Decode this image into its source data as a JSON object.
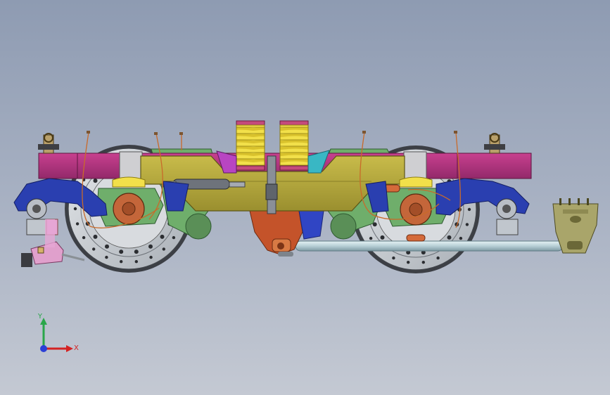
{
  "colors": {
    "background_top": "#8e9bb2",
    "background_bottom": "#c4c9d3",
    "frame_magenta": "#b0357c",
    "bolster_olive": "#b5a83c",
    "spring_yellow": "#f2e04a",
    "wheel_gray": "#cfd3d8",
    "hub_copper": "#c4663a",
    "arm_blue": "#2a3fb0",
    "gear_green": "#6fae6b",
    "cyan_part": "#39b7c4",
    "damper_gray": "#8a8f98",
    "bracket_olive": "#a9a56a",
    "axis_x": "#d42222",
    "axis_y": "#2aa64a",
    "axis_z": "#2b3fd6"
  },
  "triad": {
    "x_label": "X",
    "y_label": "Y",
    "icon": "coordinate-triad-icon"
  }
}
